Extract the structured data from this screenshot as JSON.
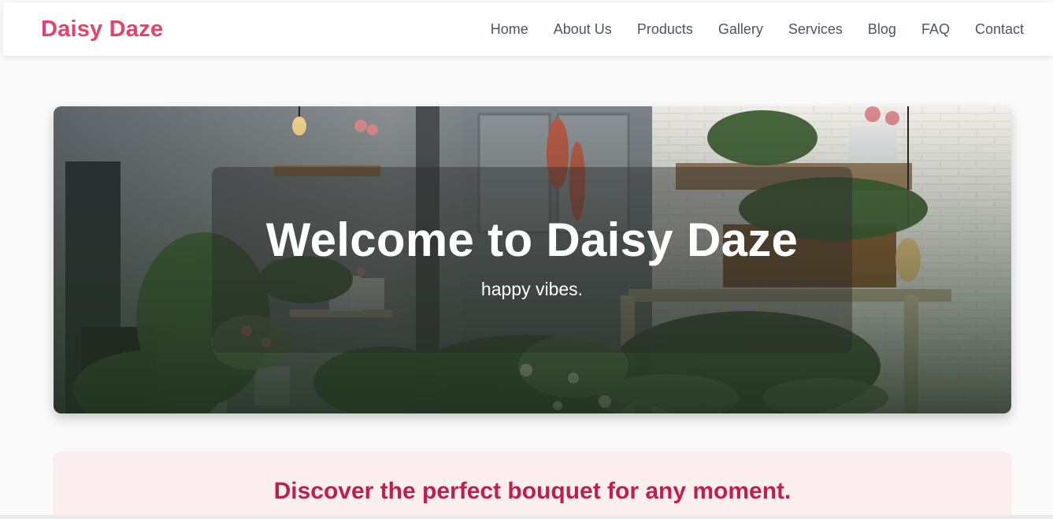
{
  "header": {
    "brand": "Daisy Daze",
    "nav": [
      "Home",
      "About Us",
      "Products",
      "Gallery",
      "Services",
      "Blog",
      "FAQ",
      "Contact"
    ]
  },
  "hero": {
    "title": "Welcome to Daisy Daze",
    "subtitle": "happy vibes."
  },
  "discover": {
    "text": "Discover the perfect bouquet for any moment."
  },
  "colors": {
    "brand": "#e8406a",
    "nav_text": "#4b5563",
    "discover_bg": "#fdeef0",
    "discover_text": "#be1f4d"
  }
}
